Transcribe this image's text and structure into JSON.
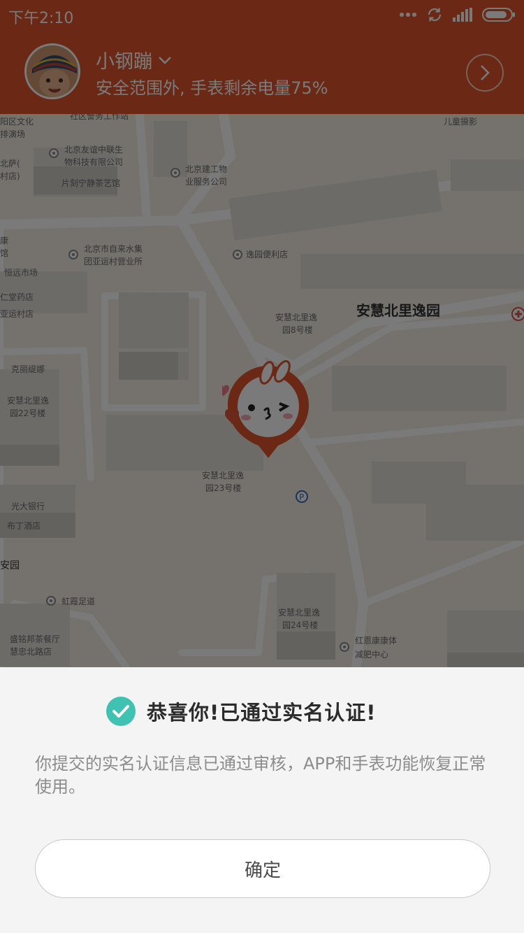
{
  "status_bar": {
    "time": "下午2:10"
  },
  "header": {
    "child_name": "小钢蹦",
    "status_text": "安全范围外, 手表剩余电量75%",
    "accent_color": "#e0562c"
  },
  "map": {
    "labels": [
      "阳区文化",
      "排演场",
      "社区警务工作站",
      "北京友谊中联生",
      "物科技有限公司",
      "北萨(",
      "村店)",
      "片刻宁静茶艺馆",
      "北京建工物",
      "业服务公司",
      "儿童摄影",
      "康",
      "馆",
      "北京市自来水集",
      "团亚运村营业所",
      "逸园便利店",
      "恒远市场",
      "仁堂药店",
      "亚运村店",
      "安慧北里逸园",
      "安慧北里逸",
      "园8号楼",
      "克丽缇娜",
      "安慧北里逸",
      "园22号楼",
      "安慧北里逸",
      "园23号楼",
      "光大银行",
      "布丁酒店",
      "安园",
      "虹霞足道",
      "安慧北里逸",
      "园24号楼",
      "盛铭邦茶餐厅",
      "慧忠北路店",
      "红恩康康体",
      "减肥中心"
    ]
  },
  "dialog": {
    "title": "恭喜你!已通过实名认证!",
    "description": "你提交的实名认证信息已通过审核，APP和手表功能恢复正常使用。",
    "confirm_label": "确定",
    "check_color": "#3fc2b1"
  }
}
